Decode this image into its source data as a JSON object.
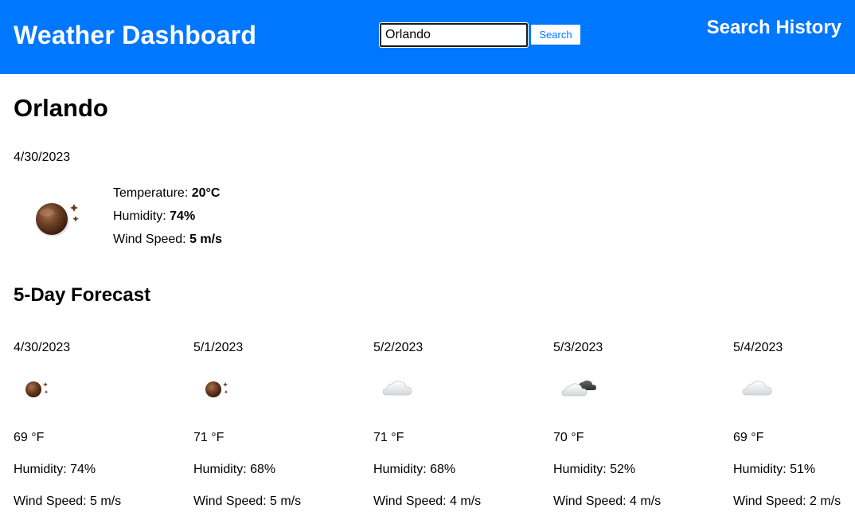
{
  "header": {
    "title": "Weather Dashboard",
    "search_value": "Orlando",
    "search_button": "Search",
    "history_label": "Search History",
    "bg_color": "#0077ff"
  },
  "current": {
    "city": "Orlando",
    "date": "4/30/2023",
    "icon": "clear-night-icon",
    "temperature_label": "Temperature:",
    "temperature": "20°C",
    "humidity_label": "Humidity:",
    "humidity": "74%",
    "wind_label": "Wind Speed:",
    "wind": "5 m/s"
  },
  "forecast": {
    "title": "5-Day Forecast",
    "days": [
      {
        "date": "4/30/2023",
        "icon": "clear-night-icon",
        "temp": "69 °F",
        "humidity": "Humidity: 74%",
        "wind": "Wind Speed: 5 m/s"
      },
      {
        "date": "5/1/2023",
        "icon": "clear-night-icon",
        "temp": "71 °F",
        "humidity": "Humidity: 68%",
        "wind": "Wind Speed: 5 m/s"
      },
      {
        "date": "5/2/2023",
        "icon": "cloud-icon",
        "temp": "71 °F",
        "humidity": "Humidity: 68%",
        "wind": "Wind Speed: 4 m/s"
      },
      {
        "date": "5/3/2023",
        "icon": "broken-clouds-icon",
        "temp": "70 °F",
        "humidity": "Humidity: 52%",
        "wind": "Wind Speed: 4 m/s"
      },
      {
        "date": "5/4/2023",
        "icon": "cloud-icon",
        "temp": "69 °F",
        "humidity": "Humidity: 51%",
        "wind": "Wind Speed: 2 m/s"
      }
    ]
  }
}
